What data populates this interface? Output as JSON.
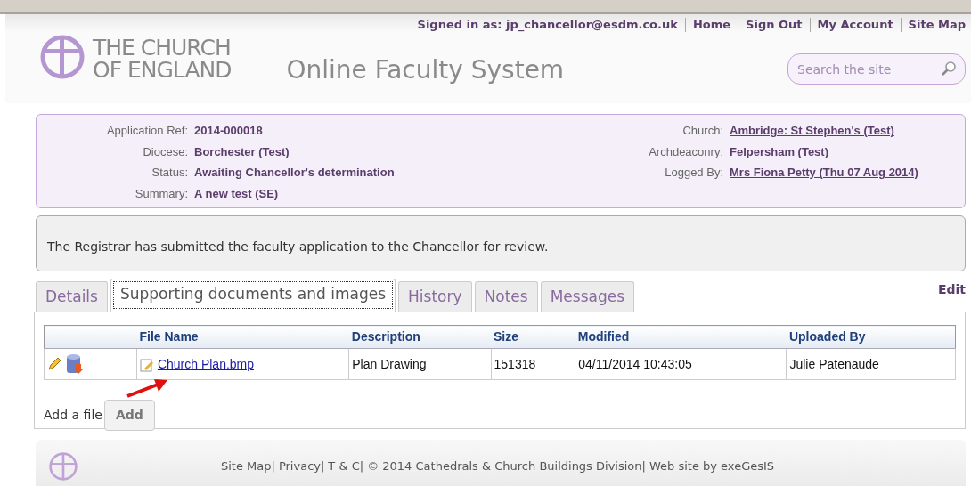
{
  "header": {
    "signed_in": "Signed in as: jp_chancellor@esdm.co.uk",
    "links": [
      "Home",
      "Sign Out",
      "My Account",
      "Site Map"
    ],
    "logo_line_1": "THE CHURCH",
    "logo_line_2": "OF ENGLAND",
    "title": "Online Faculty System",
    "search": {
      "placeholder": "Search the site"
    }
  },
  "summary": {
    "left": [
      {
        "label": "Application Ref:",
        "value": "2014-000018",
        "link": false
      },
      {
        "label": "Diocese:",
        "value": "Borchester (Test)",
        "link": false
      },
      {
        "label": "Status:",
        "value": "Awaiting Chancellor's determination",
        "link": false
      },
      {
        "label": "Summary:",
        "value": "A new test (SE)",
        "link": false
      }
    ],
    "right": [
      {
        "label": "Church:",
        "value": "Ambridge: St Stephen's (Test)",
        "link": true
      },
      {
        "label": "Archdeaconry:",
        "value": "Felpersham (Test)",
        "link": false
      },
      {
        "label": "Logged By:",
        "value": "Mrs Fiona Petty (Thu 07 Aug 2014)",
        "link": true
      }
    ]
  },
  "message": "The Registrar has submitted the faculty application to the Chancellor for review.",
  "tabs": [
    {
      "label": "Details",
      "selected": false
    },
    {
      "label": "Supporting documents and images",
      "selected": true
    },
    {
      "label": "History",
      "selected": false
    },
    {
      "label": "Notes",
      "selected": false
    },
    {
      "label": "Messages",
      "selected": false
    }
  ],
  "edit_link": "Edit",
  "table": {
    "columns": [
      "File Name",
      "Description",
      "Size",
      "Modified",
      "Uploaded By"
    ],
    "rows": [
      {
        "file_name": "Church Plan.bmp",
        "description": "Plan Drawing",
        "size": "151318",
        "modified": "04/11/2014 10:43:05",
        "uploaded_by": "Julie Patenaude"
      }
    ]
  },
  "add_label": "Add a file",
  "add_button": "Add",
  "footer": [
    "Site Map|",
    "Privacy|",
    "T & C|",
    "© 2014 Cathedrals & Church Buildings Division|",
    "Web site by exeGesIS"
  ]
}
